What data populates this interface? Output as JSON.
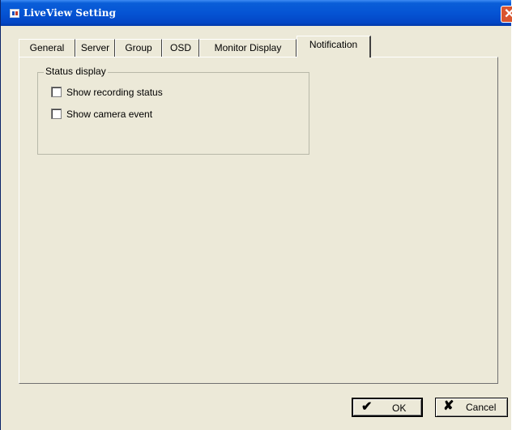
{
  "window": {
    "title": "LiveView Setting",
    "close_glyph": "✕"
  },
  "tabs": [
    {
      "label": "General"
    },
    {
      "label": "Server"
    },
    {
      "label": "Group"
    },
    {
      "label": "OSD"
    },
    {
      "label": "Monitor Display"
    },
    {
      "label": "Notification",
      "active": true
    }
  ],
  "status_display": {
    "label": "Status display",
    "options": [
      {
        "label": "Show recording status",
        "checked": false
      },
      {
        "label": "Show camera event",
        "checked": false
      }
    ]
  },
  "buttons": {
    "ok": {
      "label": "OK",
      "icon": "✔"
    },
    "cancel": {
      "label": "Cancel",
      "icon": "✘"
    }
  },
  "colors": {
    "titlebar": "#0554d4",
    "dialog_bg": "#ece9d8",
    "close_button": "#d9552f"
  }
}
